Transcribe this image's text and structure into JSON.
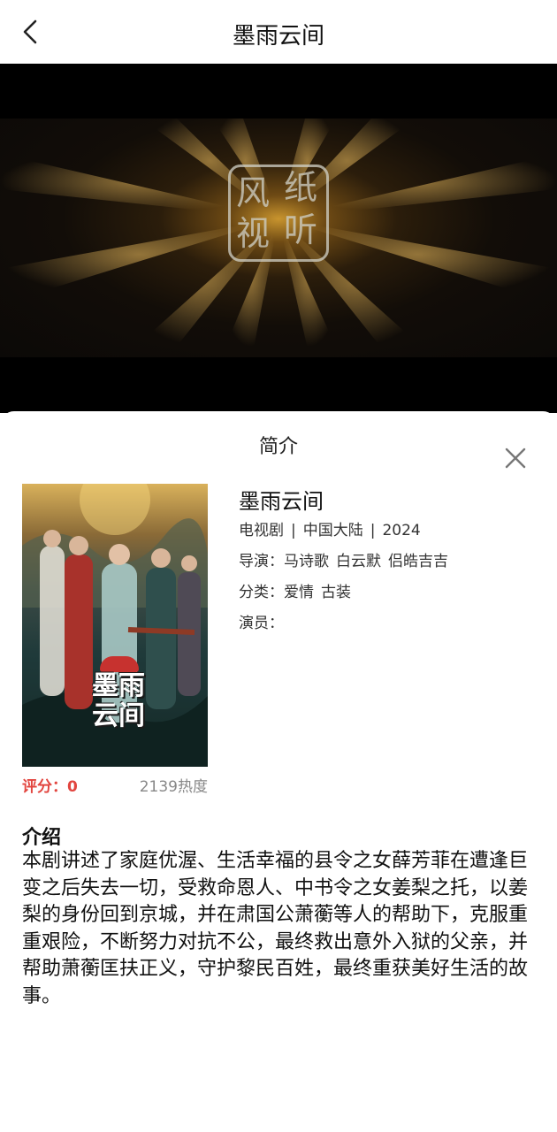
{
  "header": {
    "title": "墨雨云间"
  },
  "sheet": {
    "title": "简介",
    "drama": {
      "title": "墨雨云间",
      "type": "电视剧",
      "region": "中国大陆",
      "year": "2024",
      "director_label": "导演：",
      "directors": [
        "马诗歌",
        "白云默",
        "侣皓吉吉"
      ],
      "category_label": "分类：",
      "categories": [
        "爱情",
        "古装"
      ],
      "cast_label": "演员：",
      "rating": "评分：0",
      "heat": "2139热度",
      "poster_text": "墨雨云间"
    },
    "intro": {
      "heading": "介绍",
      "text": "本剧讲述了家庭优渥、生活幸福的县令之女薛芳菲在遭逢巨变之后失去一切，受救命恩人、中书令之女姜梨之托，以姜梨的身份回到京城，并在肃国公萧蘅等人的帮助下，克服重重艰险，不断努力对抗不公，最终救出意外入狱的父亲，并帮助萧蘅匡扶正义，守护黎民百姓，最终重获美好生活的故事。"
    }
  },
  "video": {
    "logo_chars": [
      "风",
      "纸",
      "视",
      "听"
    ]
  },
  "colors": {
    "rating_red": "#e2453f",
    "heat_gray": "#888888"
  },
  "icons": {
    "back": "chevron-left-icon",
    "close": "close-icon"
  }
}
